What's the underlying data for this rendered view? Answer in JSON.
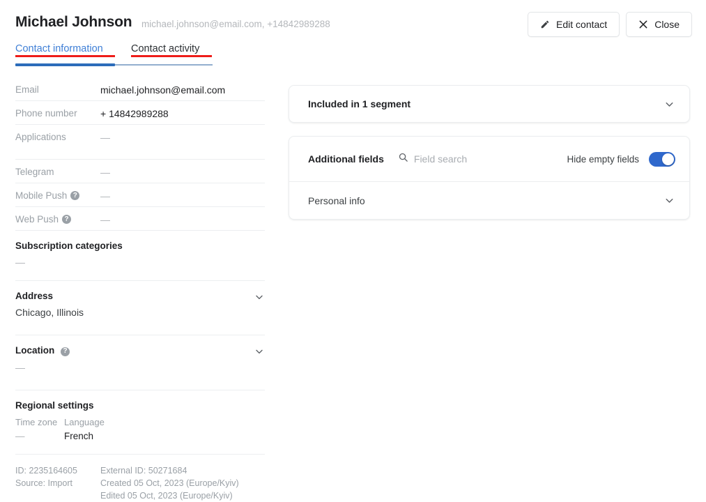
{
  "header": {
    "contact_name": "Michael Johnson",
    "contact_subtitle": "michael.johnson@email.com, +14842989288",
    "edit_button": "Edit contact",
    "close_button": "Close"
  },
  "tabs": [
    {
      "label": "Contact information",
      "active": true
    },
    {
      "label": "Contact activity",
      "active": false
    }
  ],
  "contact_fields": [
    {
      "key": "Email",
      "value": "michael.johnson@email.com",
      "help": false
    },
    {
      "key": "Phone number",
      "value": "+ 14842989288",
      "help": false
    },
    {
      "key": "Applications",
      "value": "—",
      "help": false
    },
    {
      "key": "Telegram",
      "value": "—",
      "help": false
    },
    {
      "key": "Mobile Push",
      "value": "—",
      "help": true
    },
    {
      "key": "Web Push",
      "value": "—",
      "help": true
    }
  ],
  "sections": {
    "subscription": {
      "title": "Subscription categories",
      "value": "—"
    },
    "address": {
      "title": "Address",
      "value": "Chicago, Illinois"
    },
    "location": {
      "title": "Location",
      "value": "—"
    },
    "regional": {
      "title": "Regional settings",
      "timezone_label": "Time zone",
      "timezone_value": "—",
      "language_label": "Language",
      "language_value": "French"
    }
  },
  "meta": {
    "id": "ID: 2235164605",
    "source": "Source:  Import",
    "external_id": "External ID: 50271684",
    "created": "Created 05 Oct, 2023 (Europe/Kyiv)",
    "edited": "Edited 05 Oct, 2023 (Europe/Kyiv)"
  },
  "right": {
    "segment_card": {
      "text": "Included in  1  segment"
    },
    "additional_fields": {
      "title": "Additional fields",
      "search_placeholder": "Field search",
      "search_value": "",
      "hide_empty_label": "Hide empty fields",
      "hide_empty_on": true,
      "groups": [
        {
          "label": "Personal info"
        }
      ]
    }
  },
  "colors": {
    "accent_blue": "#2c6cba",
    "tab_link": "#3f7fd6",
    "annotation_red": "#ee1c19",
    "toggle_on": "#2f68cc"
  }
}
